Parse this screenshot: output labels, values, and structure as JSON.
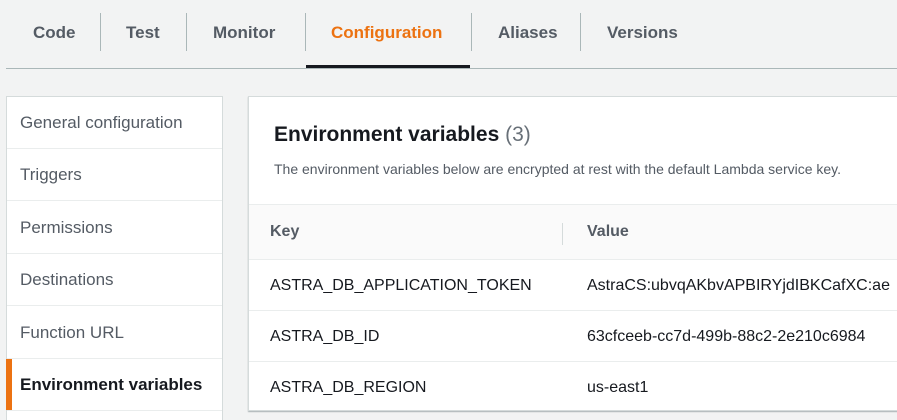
{
  "tabs": [
    {
      "label": "Code"
    },
    {
      "label": "Test"
    },
    {
      "label": "Monitor"
    },
    {
      "label": "Configuration"
    },
    {
      "label": "Aliases"
    },
    {
      "label": "Versions"
    }
  ],
  "sidebar": {
    "items": [
      {
        "label": "General configuration"
      },
      {
        "label": "Triggers"
      },
      {
        "label": "Permissions"
      },
      {
        "label": "Destinations"
      },
      {
        "label": "Function URL"
      },
      {
        "label": "Environment variables"
      }
    ]
  },
  "panel": {
    "title": "Environment variables",
    "count": "(3)",
    "description": "The environment variables below are encrypted at rest with the default Lambda service key.",
    "columns": {
      "key": "Key",
      "value": "Value"
    },
    "rows": [
      {
        "key": "ASTRA_DB_APPLICATION_TOKEN",
        "value": "AstraCS:ubvqAKbvAPBIRYjdIBKCafXC:ae"
      },
      {
        "key": "ASTRA_DB_ID",
        "value": "63cfceeb-cc7d-499b-88c2-2e210c6984"
      },
      {
        "key": "ASTRA_DB_REGION",
        "value": "us-east1"
      }
    ]
  },
  "colors": {
    "accent": "#ec7211",
    "text": "#16191f",
    "muted": "#545b64",
    "background": "#f2f3f3"
  }
}
